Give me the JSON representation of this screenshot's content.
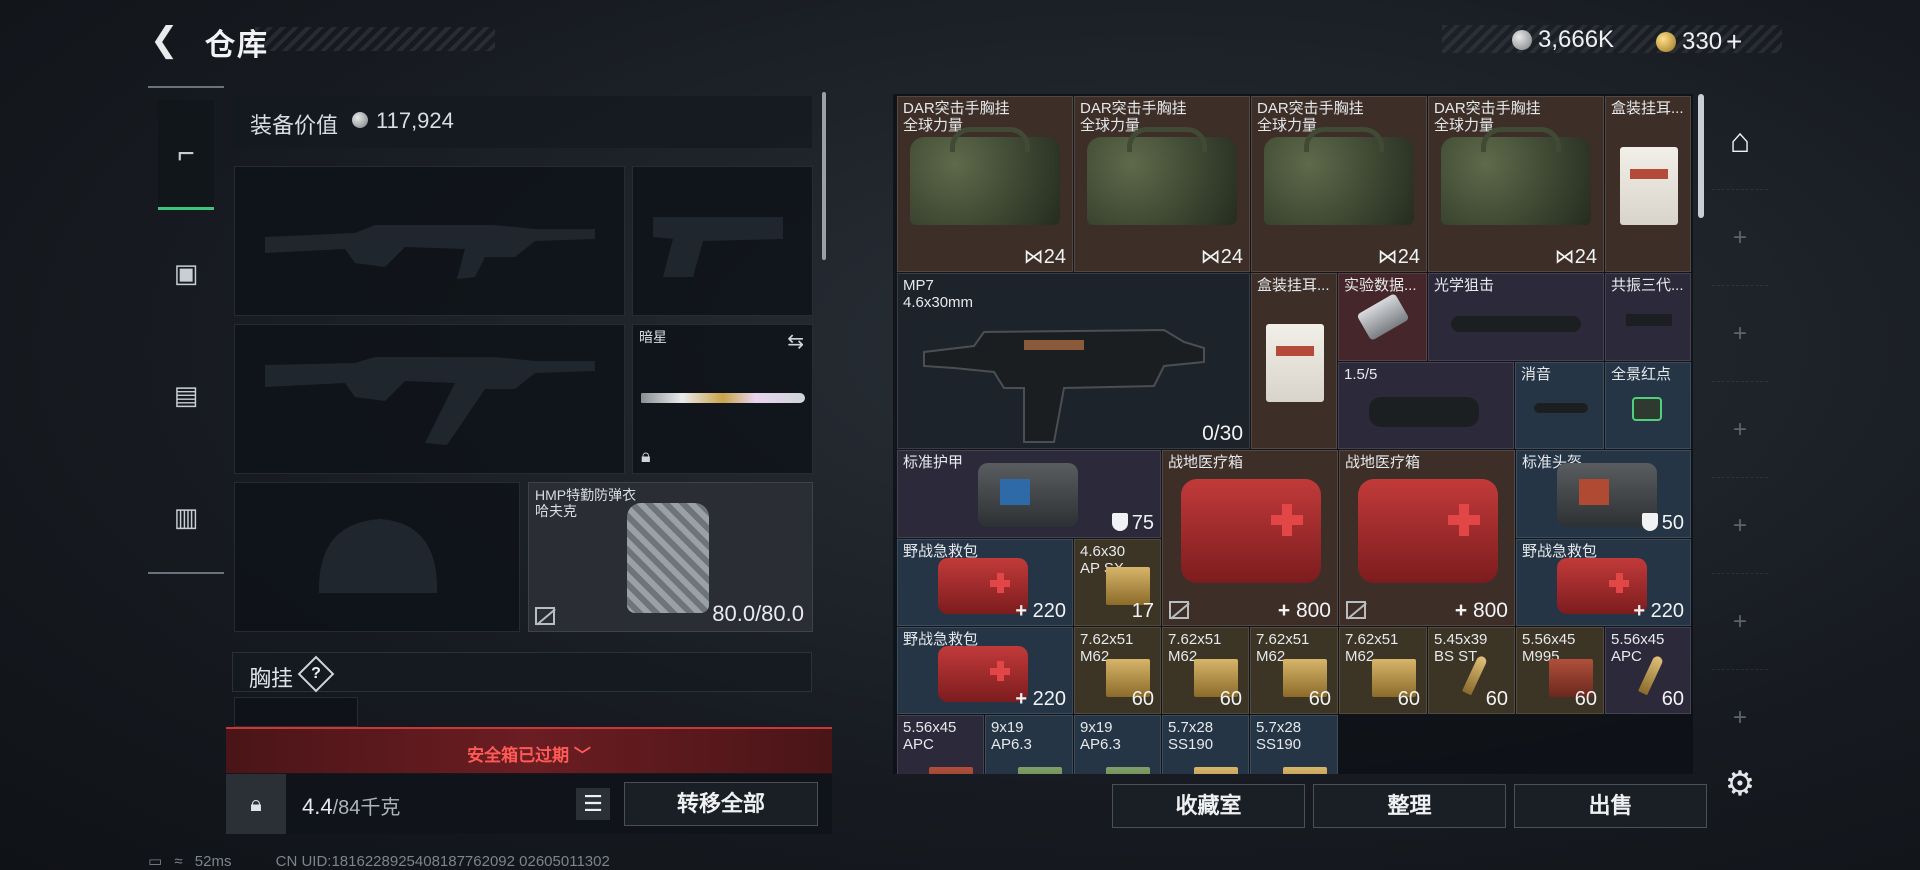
{
  "header": {
    "title": "仓库",
    "back_icon": "back-arrow-icon",
    "silver_amount": "3,666K",
    "gold_amount": "330",
    "add_label": "+"
  },
  "rail": {
    "items": [
      {
        "icon": "pistol-icon",
        "glyph": "⌐",
        "active": true
      },
      {
        "icon": "backpack-icon",
        "glyph": "▣",
        "active": false
      },
      {
        "icon": "vest-icon",
        "glyph": "▤",
        "active": false
      },
      {
        "icon": "toolbox-icon",
        "glyph": "▥",
        "active": false
      }
    ]
  },
  "loadout": {
    "equip_value_label": "装备价值",
    "equip_value": "117,924",
    "melee_name": "暗星",
    "armor_name_line1": "HMP特勤防弹衣",
    "armor_name_line2": "哈夫克",
    "armor_durability": "80.0/80.0",
    "chest_label": "胸挂",
    "help_label": "?",
    "safebox_expired": "安全箱已过期",
    "weight_current": "4.4",
    "weight_max": "/84千克",
    "transfer_all": "转移全部"
  },
  "storage": {
    "items": [
      {
        "name1": "DAR突击手胸挂",
        "name2": "全球力量",
        "qty": "24"
      },
      {
        "name1": "DAR突击手胸挂",
        "name2": "全球力量",
        "qty": "24"
      },
      {
        "name1": "DAR突击手胸挂",
        "name2": "全球力量",
        "qty": "24"
      },
      {
        "name1": "DAR突击手胸挂",
        "name2": "全球力量",
        "qty": "24"
      },
      {
        "name1": "盒装挂耳..."
      },
      {
        "name1": "MP7",
        "name2": "4.6x30mm",
        "qty": "0/30"
      },
      {
        "name1": "盒装挂耳..."
      },
      {
        "name1": "实验数据..."
      },
      {
        "name1": "光学狙击"
      },
      {
        "name1": "共振三代..."
      },
      {
        "name1": "1.5/5"
      },
      {
        "name1": "消音"
      },
      {
        "name1": "全景红点"
      },
      {
        "name1": "标准护甲",
        "qty": "75"
      },
      {
        "name1": "战地医疗箱",
        "qty": "800"
      },
      {
        "name1": "战地医疗箱",
        "qty": "800"
      },
      {
        "name1": "标准头盔",
        "qty": "50"
      },
      {
        "name1": "野战急救包",
        "qty": "220"
      },
      {
        "name1": "4.6x30",
        "name2": "AP SX",
        "qty": "17"
      },
      {
        "name1": "野战急救包",
        "qty": "220"
      },
      {
        "name1": "野战急救包",
        "qty": "220"
      },
      {
        "name1": "7.62x51",
        "name2": "M62",
        "qty": "60"
      },
      {
        "name1": "7.62x51",
        "name2": "M62",
        "qty": "60"
      },
      {
        "name1": "7.62x51",
        "name2": "M62",
        "qty": "60"
      },
      {
        "name1": "7.62x51",
        "name2": "M62",
        "qty": "60"
      },
      {
        "name1": "5.45x39",
        "name2": "BS ST",
        "qty": "60"
      },
      {
        "name1": "5.56x45",
        "name2": "M995",
        "qty": "60"
      },
      {
        "name1": "5.56x45",
        "name2": "APC",
        "qty": "60"
      },
      {
        "name1": "5.56x45",
        "name2": "APC"
      },
      {
        "name1": "9x19",
        "name2": "AP6.3"
      },
      {
        "name1": "9x19",
        "name2": "AP6.3"
      },
      {
        "name1": "5.7x28",
        "name2": "SS190"
      },
      {
        "name1": "5.7x28",
        "name2": "SS190"
      }
    ]
  },
  "actions": {
    "collection": "收藏室",
    "organize": "整理",
    "sell": "出售"
  },
  "status": {
    "ping": "52ms",
    "uid": "CN UID:1816228925408187762092 02605011302"
  },
  "colors": {
    "accent_green": "#3fc47a",
    "alert_red": "#c73838"
  }
}
